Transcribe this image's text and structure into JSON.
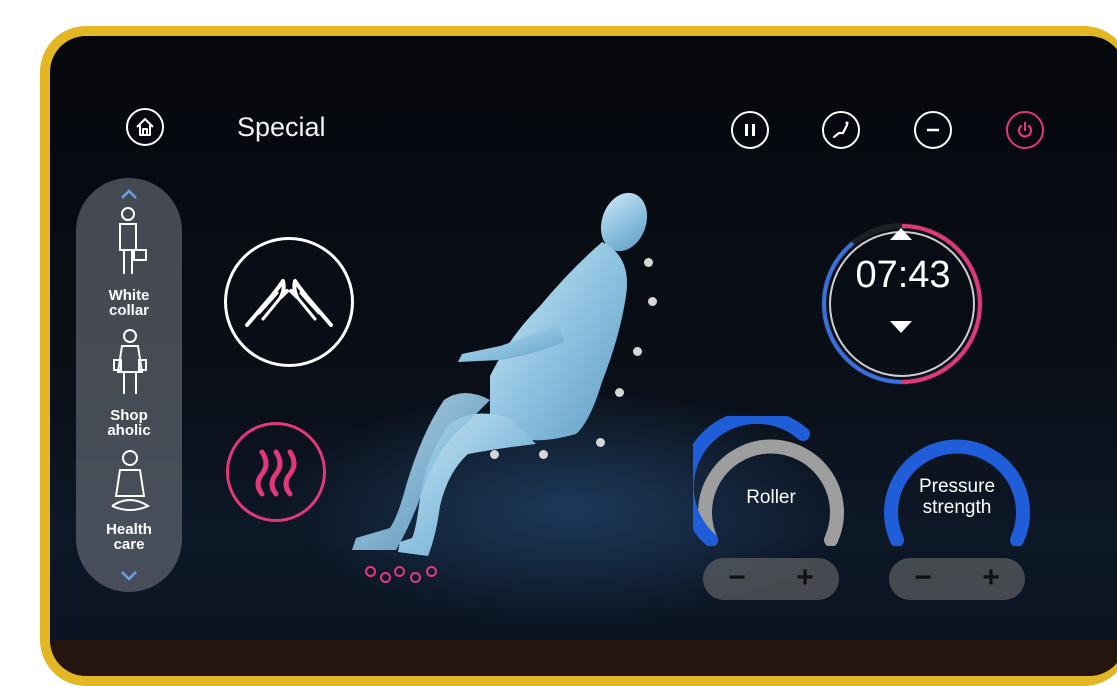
{
  "header": {
    "title": "Special"
  },
  "top_icons": [
    "home-icon",
    "pause-icon",
    "recline-icon",
    "minus-icon",
    "power-icon"
  ],
  "sidebar": {
    "items": [
      {
        "label_line1": "White",
        "label_line2": "collar",
        "icon": "office-worker-icon"
      },
      {
        "label_line1": "Shop",
        "label_line2": "aholic",
        "icon": "shopper-icon"
      },
      {
        "label_line1": "Health",
        "label_line2": "care",
        "icon": "meditation-icon"
      }
    ]
  },
  "modes": [
    "hands-massage-icon",
    "heat-icon"
  ],
  "timer": {
    "value": "07:43"
  },
  "roller": {
    "label": "Roller",
    "minus": "−",
    "plus": "+"
  },
  "pressure": {
    "label_line1": "Pressure",
    "label_line2": "strength",
    "minus": "−",
    "plus": "+"
  },
  "colors": {
    "frame": "#e3b623",
    "accent_blue": "#1f5ed8",
    "accent_pink": "#e2387a",
    "power": "#e2387a"
  }
}
